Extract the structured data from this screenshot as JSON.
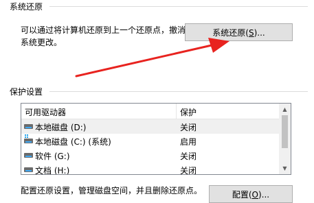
{
  "system_restore": {
    "group_title": "系统还原",
    "description_line1": "可以通过将计算机还原到上一个还原点，撤消",
    "description_line2": "系统更改。",
    "button_text": "系统还原(",
    "button_mnemonic": "S",
    "button_suffix": ")..."
  },
  "protection": {
    "group_title": "保护设置",
    "columns": {
      "drive": "可用驱动器",
      "protection": "保护"
    },
    "rows": [
      {
        "drive": "本地磁盘 (D:)",
        "status": "关闭",
        "icon": "disk-icon",
        "selected": true
      },
      {
        "drive": "本地磁盘 (C:) (系统)",
        "status": "启用",
        "icon": "system-disk-icon",
        "selected": false
      },
      {
        "drive": "软件 (G:)",
        "status": "关闭",
        "icon": "disk-icon",
        "selected": false
      },
      {
        "drive": "文档 (H:)",
        "status": "关闭",
        "icon": "disk-icon",
        "selected": false
      }
    ]
  },
  "configure": {
    "description": "配置还原设置，管理磁盘空间，并且删除还原点。",
    "button_text": "配置(",
    "button_mnemonic": "O",
    "button_suffix": ")..."
  },
  "annotation": {
    "arrow_color": "#e8231f",
    "icon": "red-arrow-icon"
  }
}
